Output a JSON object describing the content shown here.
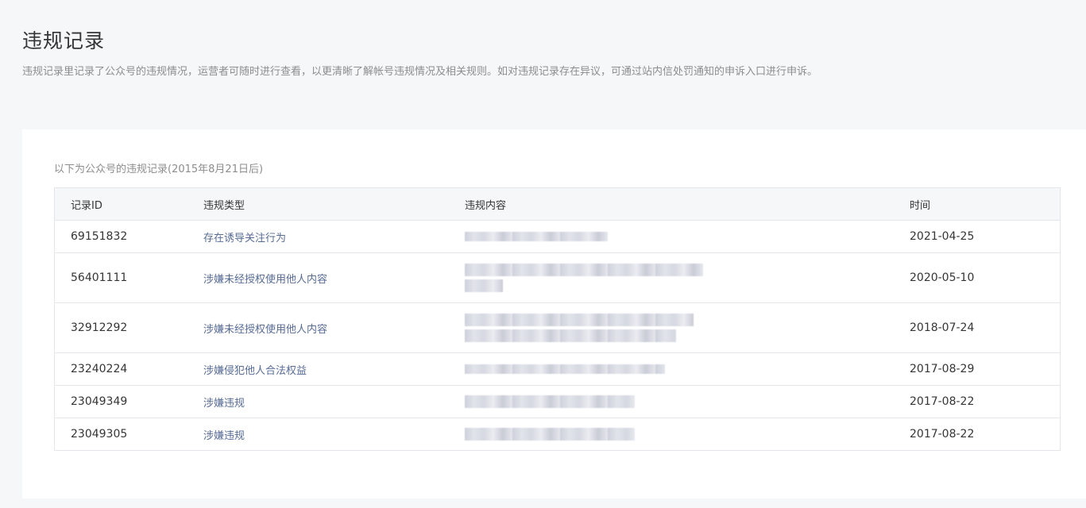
{
  "page": {
    "title": "违规记录",
    "description": "违规记录里记录了公众号的违规情况，运营者可随时进行查看，以更清晰了解帐号违规情况及相关规则。如对违规记录存在异议，可通过站内信处罚通知的申诉入口进行申诉。"
  },
  "card": {
    "caption": "以下为公众号的违规记录(2015年8月21日后)"
  },
  "table": {
    "headers": {
      "id": "记录ID",
      "type": "违规类型",
      "content": "违规内容",
      "time": "时间"
    },
    "rows": [
      {
        "id": "69151832",
        "type": "存在诱导关注行为",
        "time": "2021-04-25"
      },
      {
        "id": "56401111",
        "type": "涉嫌未经授权使用他人内容",
        "time": "2020-05-10"
      },
      {
        "id": "32912292",
        "type": "涉嫌未经授权使用他人内容",
        "time": "2018-07-24"
      },
      {
        "id": "23240224",
        "type": "涉嫌侵犯他人合法权益",
        "time": "2017-08-29"
      },
      {
        "id": "23049349",
        "type": "涉嫌违规",
        "time": "2017-08-22"
      },
      {
        "id": "23049305",
        "type": "涉嫌违规",
        "time": "2017-08-22"
      }
    ]
  },
  "colors": {
    "page_bg": "#f6f7f9",
    "card_bg": "#ffffff",
    "link": "#576b95",
    "muted_text": "#8d8d8d",
    "border": "#e4e6eb"
  }
}
